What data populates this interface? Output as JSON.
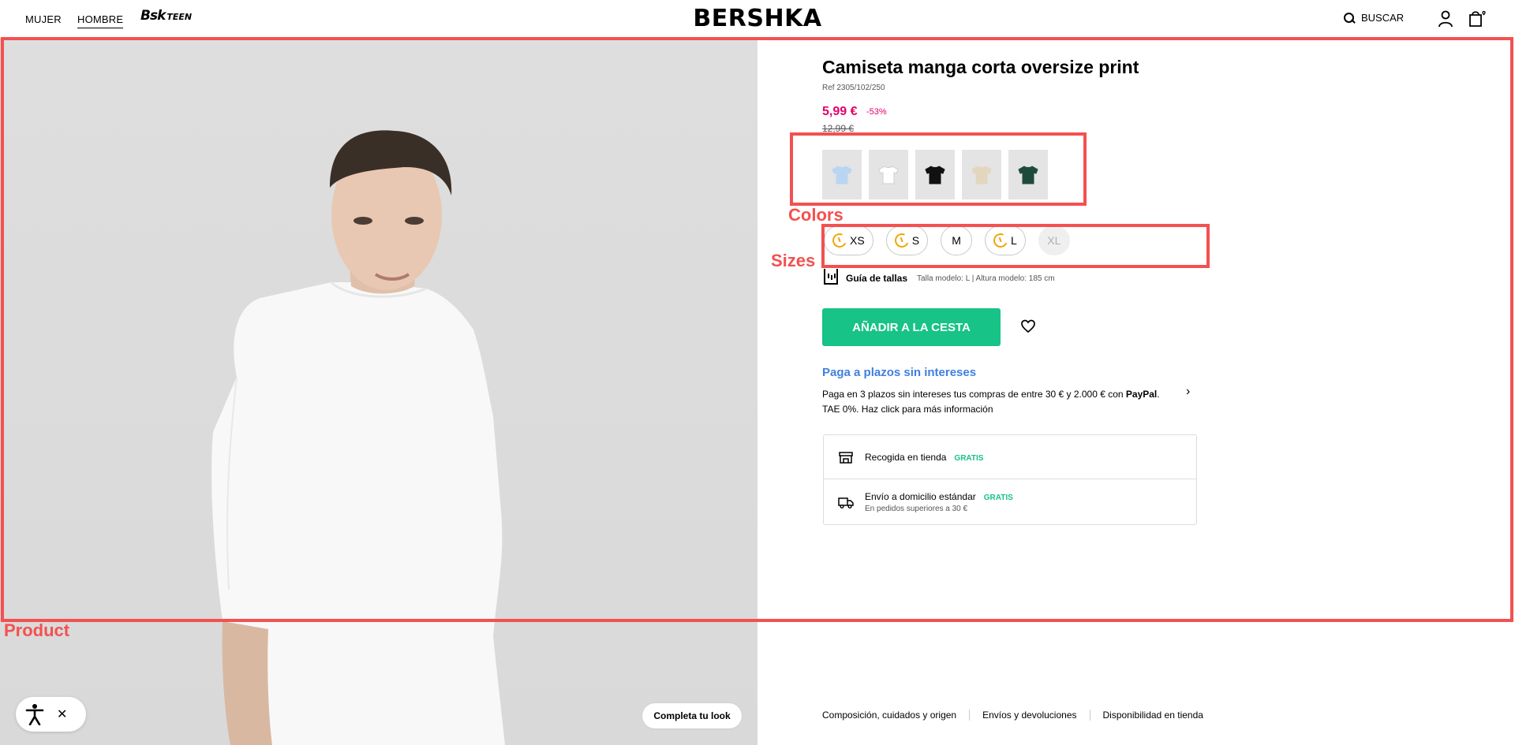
{
  "header": {
    "nav": [
      "MUJER",
      "HOMBRE"
    ],
    "active_nav": "HOMBRE",
    "bsk_logo": "Bsk",
    "bsk_teen": "TEEN",
    "brand": "BERSHKA",
    "search_label": "BUSCAR",
    "icons": [
      "search-icon",
      "user-icon",
      "shopping-bag-icon"
    ]
  },
  "product": {
    "title": "Camiseta manga corta oversize print",
    "ref": "Ref 2305/102/250",
    "price": "5,99 €",
    "discount": "-53%",
    "old_price": "12,99 €",
    "colors": [
      {
        "name": "light-blue",
        "hex": "#b9d5f2"
      },
      {
        "name": "white",
        "hex": "#ffffff"
      },
      {
        "name": "black",
        "hex": "#111111"
      },
      {
        "name": "beige",
        "hex": "#e3d6bf"
      },
      {
        "name": "dark-green",
        "hex": "#1e4a3c"
      }
    ],
    "sizes": [
      {
        "label": "XS",
        "low_stock": true,
        "available": true
      },
      {
        "label": "S",
        "low_stock": true,
        "available": true
      },
      {
        "label": "M",
        "low_stock": false,
        "available": true
      },
      {
        "label": "L",
        "low_stock": true,
        "available": true
      },
      {
        "label": "XL",
        "low_stock": false,
        "available": false
      }
    ],
    "size_guide": "Guía de tallas",
    "model_info": "Talla modelo: L  |  Altura modelo: 185 cm",
    "add_to_cart": "AÑADIR A LA CESTA",
    "paypal_title": "Paga a plazos sin intereses",
    "paypal_text_1": "Paga en 3 plazos sin intereses tus compras de entre 30 € y 2.000 € con ",
    "paypal_brand": "PayPal",
    "paypal_text_2": ".",
    "paypal_text_3": "TAE 0%. Haz click para más información",
    "delivery": {
      "pickup_label": "Recogida en tienda",
      "pickup_price": "GRATIS",
      "home_label": "Envío a domicilio estándar",
      "home_price": "GRATIS",
      "home_note": "En pedidos superiores a 30 €"
    }
  },
  "footer_links": [
    "Composición, cuidados y origen",
    "Envíos y devoluciones",
    "Disponibilidad en tienda"
  ],
  "complete_look": "Completa tu look",
  "annotations": {
    "product": "Product",
    "colors": "Colors",
    "sizes": "Sizes",
    "color": "#f45050"
  },
  "colors": {
    "accent_green": "#17c387",
    "price_pink": "#e5006c",
    "paypal_blue": "#3f7fe0"
  }
}
